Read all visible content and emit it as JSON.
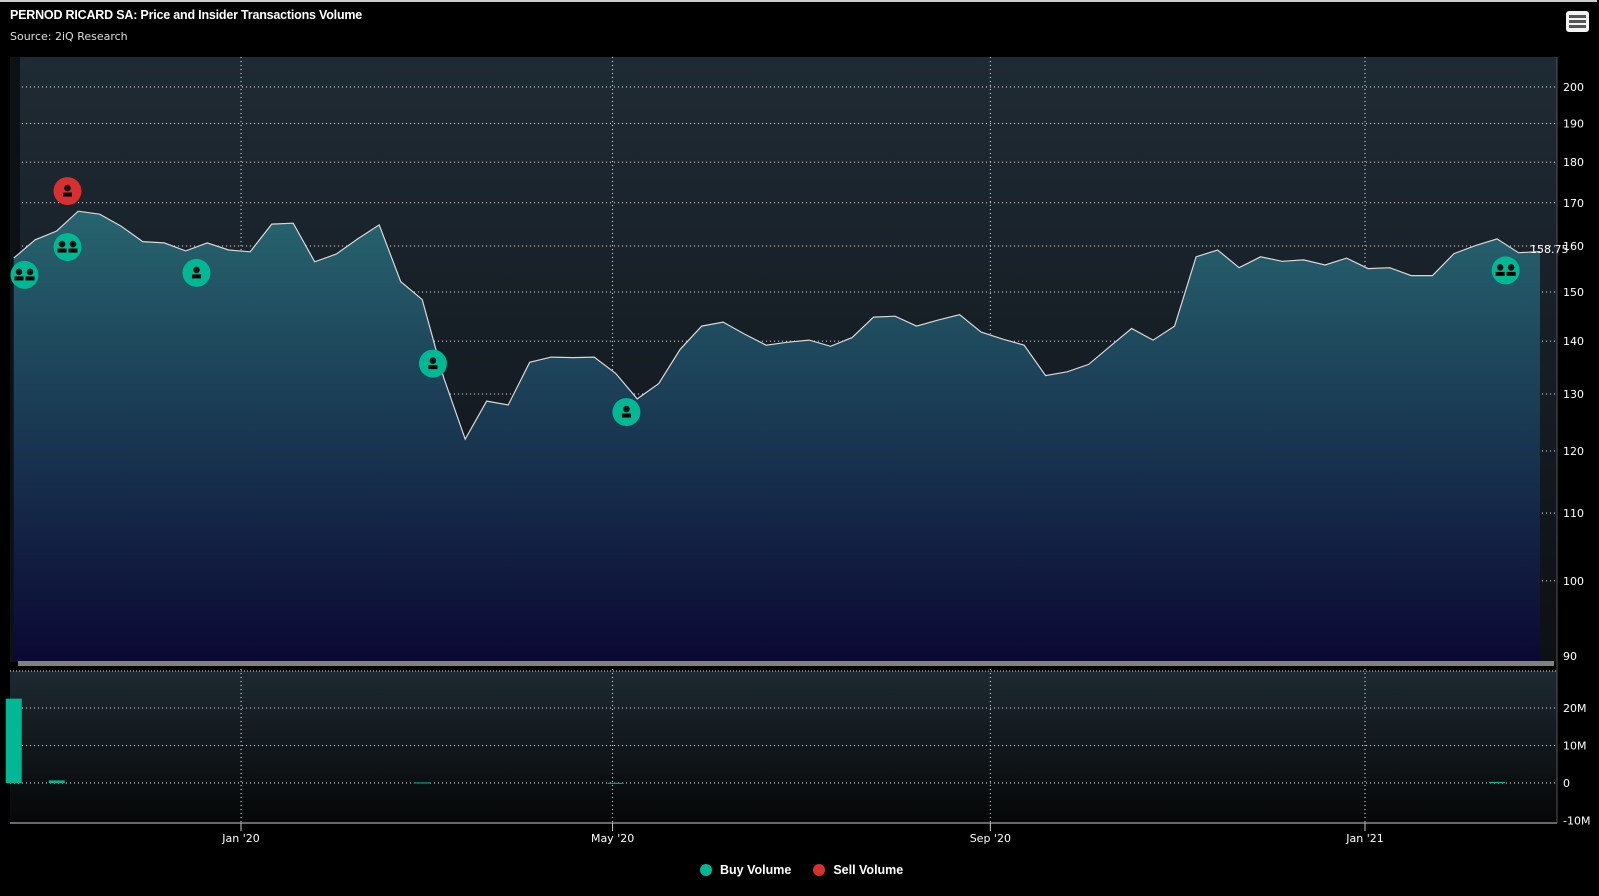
{
  "header": {
    "title": "PERNOD RICARD SA: Price and Insider Transactions Volume",
    "subtitle": "Source: 2iQ Research",
    "menu_icon": "hamburger-menu-icon"
  },
  "colors": {
    "buy": "#00b894",
    "sell": "#d63031",
    "price_line": "#d8d8d8",
    "last_price": "#00ff00",
    "area_top": "#27646f",
    "area_bottom": "#0b0833"
  },
  "chart_data": [
    {
      "type": "area",
      "name": "Price",
      "y_scale": "log",
      "ylim": [
        90,
        205
      ],
      "x_range": [
        "2019-10-21",
        "2021-03-01"
      ],
      "x_ticks": [
        {
          "label": "Jan '20",
          "date": "2020-01-01"
        },
        {
          "label": "May '20",
          "date": "2020-05-01"
        },
        {
          "label": "Sep '20",
          "date": "2020-09-01"
        },
        {
          "label": "Jan '21",
          "date": "2021-01-01"
        }
      ],
      "y_ticks": [
        90,
        100,
        110,
        120,
        130,
        140,
        150,
        160,
        170,
        180,
        190,
        200
      ],
      "grid": true,
      "values": [
        157.3,
        161.4,
        163.4,
        168.0,
        167.3,
        164.5,
        161.0,
        160.7,
        158.9,
        160.7,
        159.1,
        158.7,
        165.0,
        165.2,
        156.5,
        158.2,
        161.6,
        164.8,
        152.2,
        148.4,
        133.0,
        122.0,
        128.7,
        128.0,
        135.9,
        136.9,
        136.8,
        136.9,
        133.8,
        129.1,
        131.9,
        138.4,
        143.0,
        143.8,
        141.4,
        139.2,
        139.8,
        140.2,
        139.0,
        140.7,
        144.8,
        145.0,
        143.0,
        144.2,
        145.3,
        141.8,
        140.4,
        139.2,
        133.4,
        134.1,
        135.5,
        139.0,
        142.5,
        140.2,
        143.0,
        157.6,
        159.1,
        155.2,
        157.6,
        156.6,
        156.9,
        155.8,
        157.3,
        155.0,
        155.2,
        153.5,
        153.5,
        158.3,
        160.1,
        161.6,
        158.5,
        158.75
      ],
      "last_price_label": "158.75",
      "insider_markers": [
        {
          "index": 0.5,
          "type": "buy",
          "multiple": true
        },
        {
          "index": 2.5,
          "type": "sell",
          "multiple": false
        },
        {
          "index": 2.5,
          "type": "buy",
          "multiple": true
        },
        {
          "index": 8.5,
          "type": "buy",
          "multiple": false
        },
        {
          "index": 19.5,
          "type": "buy",
          "multiple": false
        },
        {
          "index": 28.5,
          "type": "buy",
          "multiple": false
        },
        {
          "index": 69.4,
          "type": "buy",
          "multiple": true
        }
      ]
    },
    {
      "type": "bar",
      "name": "Insider Volume",
      "ylim": [
        -10000000,
        30000000
      ],
      "y_ticks": [
        {
          "v": -10000000,
          "label": "-10M"
        },
        {
          "v": 0,
          "label": "0"
        },
        {
          "v": 10000000,
          "label": "10M"
        },
        {
          "v": 20000000,
          "label": "20M"
        }
      ],
      "series": [
        {
          "name": "Buy Volume",
          "bars": [
            {
              "index": 0,
              "value": 22500000
            },
            {
              "index": 2,
              "value": 700000
            },
            {
              "index": 19,
              "value": 150000
            },
            {
              "index": 28,
              "value": 50000
            },
            {
              "index": 69,
              "value": 300000
            }
          ]
        },
        {
          "name": "Sell Volume",
          "bars": []
        }
      ]
    }
  ],
  "legend": [
    {
      "label": "Buy Volume",
      "color": "#00b894"
    },
    {
      "label": "Sell Volume",
      "color": "#d63031"
    }
  ]
}
